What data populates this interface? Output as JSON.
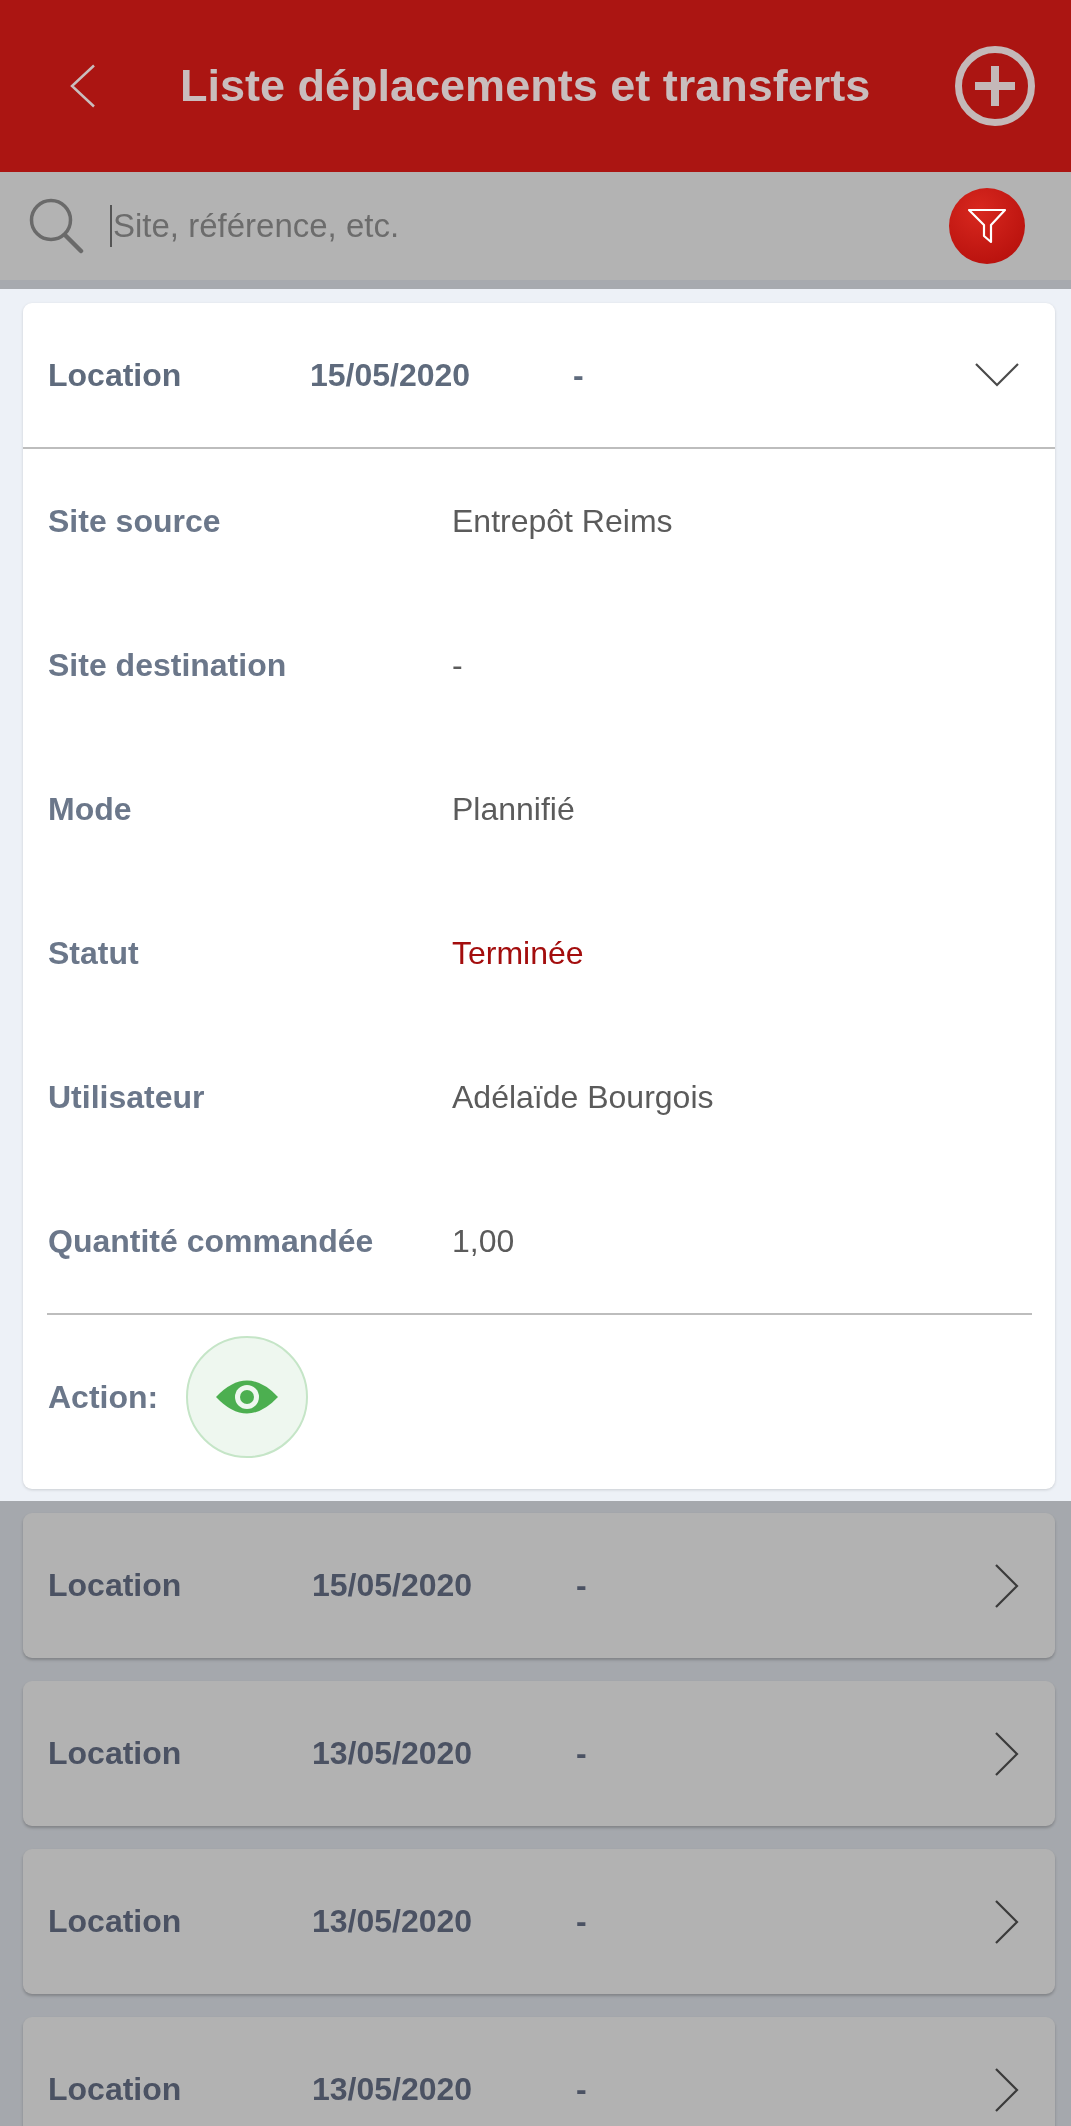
{
  "header": {
    "title": "Liste déplacements et transferts"
  },
  "search": {
    "placeholder": "Site, référence, etc."
  },
  "transfers": [
    {
      "title": "Location",
      "date": "15/05/2020",
      "column_3": "-",
      "expanded": true,
      "details": [
        {
          "label": "Site source",
          "value": "Entrepôt Reims",
          "kind": "text"
        },
        {
          "label": "Site destination",
          "value": "-",
          "kind": "text"
        },
        {
          "label": "Mode",
          "value": "Plannifié",
          "kind": "text"
        },
        {
          "label": "Statut",
          "value": "Terminée",
          "kind": "status"
        },
        {
          "label": "Utilisateur",
          "value": "Adélaïde Bourgois",
          "kind": "text"
        },
        {
          "label": "Quantité commandée",
          "value": "1,00",
          "kind": "text"
        }
      ],
      "action_label": "Action:"
    },
    {
      "title": "Location",
      "date": "15/05/2020",
      "column_3": "-",
      "expanded": false
    },
    {
      "title": "Location",
      "date": "13/05/2020",
      "column_3": "-",
      "expanded": false
    },
    {
      "title": "Location",
      "date": "13/05/2020",
      "column_3": "-",
      "expanded": false
    },
    {
      "title": "Location",
      "date": "13/05/2020",
      "column_3": "-",
      "expanded": false
    }
  ]
}
